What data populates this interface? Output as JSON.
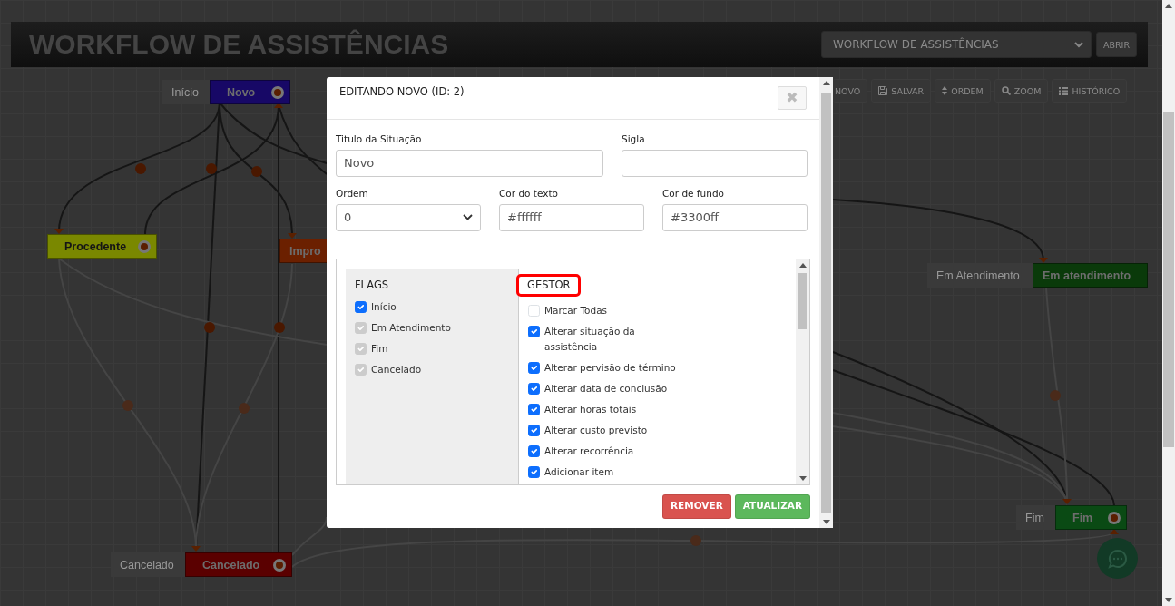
{
  "header": {
    "title": "WORKFLOW DE ASSISTÊNCIAS",
    "workflow_select": "WORKFLOW DE ASSISTÊNCIAS",
    "open_button": "ABRIR"
  },
  "toolbar": [
    {
      "label": "NOVO",
      "kind": "partial"
    },
    {
      "label": "SALVAR",
      "kind": "save"
    },
    {
      "label": "ORDEM",
      "kind": "sort"
    },
    {
      "label": "ZOOM",
      "kind": "search"
    },
    {
      "label": "HISTÓRICO",
      "kind": "list"
    }
  ],
  "nodes": [
    {
      "tag": "Início",
      "name": "Novo",
      "color": "#170866"
    },
    {
      "name": "Procedente",
      "color": "#7a8800"
    },
    {
      "name": "Impro",
      "color": "#6b2000"
    },
    {
      "tag": "Em Atendimento",
      "name": "Em atendimento",
      "color": "#0a3a0a"
    },
    {
      "tag": "Fim",
      "name": "Fim",
      "color": "#0a4a14"
    },
    {
      "tag": "Cancelado",
      "name": "Cancelado",
      "color": "#5a0000"
    }
  ],
  "modal": {
    "title": "EDITANDO NOVO (ID: 2)",
    "close": "✖",
    "fields": [
      {
        "label": "Titulo da Situação",
        "value": "Novo",
        "kind": "text"
      },
      {
        "label": "Sigla",
        "kind": "text"
      },
      {
        "label": "Ordem",
        "value": "0",
        "kind": "select"
      },
      {
        "label": "Cor do texto",
        "value": "#ffffff",
        "kind": "text"
      },
      {
        "label": "Cor de fundo",
        "value": "#3300ff",
        "kind": "text"
      }
    ],
    "flags": {
      "heading": "FLAGS",
      "items": [
        {
          "label": "Início",
          "checked": true,
          "disabled": false
        },
        {
          "label": "Em Atendimento",
          "checked": true,
          "disabled": true
        },
        {
          "label": "Fim",
          "checked": true,
          "disabled": true
        },
        {
          "label": "Cancelado",
          "checked": true,
          "disabled": true
        }
      ]
    },
    "gestor": {
      "heading": "GESTOR",
      "highlighted": true,
      "items": [
        {
          "label": "Marcar Todas",
          "checked": false
        },
        {
          "label": "Alterar situação da assistência",
          "checked": true
        },
        {
          "label": "Alterar pervisão de término",
          "checked": true
        },
        {
          "label": "Alterar data de conclusão",
          "checked": true
        },
        {
          "label": "Alterar horas totais",
          "checked": true
        },
        {
          "label": "Alterar custo previsto",
          "checked": true
        },
        {
          "label": "Alterar recorrência",
          "checked": true
        },
        {
          "label": "Adicionar item",
          "checked": true
        }
      ]
    },
    "buttons": [
      {
        "label": "REMOVER",
        "kind": "danger"
      },
      {
        "label": "ATUALIZAR",
        "kind": "success"
      }
    ]
  }
}
